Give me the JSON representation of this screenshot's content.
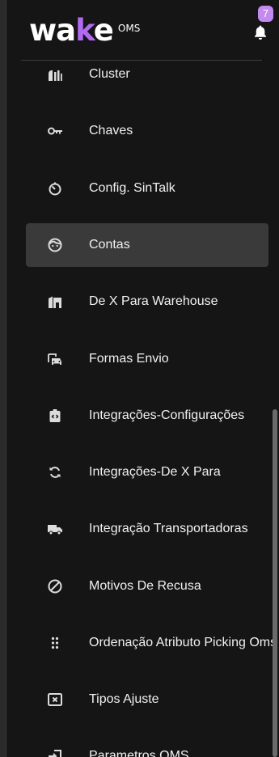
{
  "header": {
    "logo_text_a": "wa",
    "logo_text_k": "k",
    "logo_text_b": "e",
    "logo_sub": "OMS",
    "notification_count": "7"
  },
  "menu": {
    "items": [
      {
        "label": "Cluster",
        "icon": "cluster-icon"
      },
      {
        "label": "Chaves",
        "icon": "key-icon"
      },
      {
        "label": "Config. SinTalk",
        "icon": "timer-icon"
      },
      {
        "label": "Contas",
        "icon": "face-icon"
      },
      {
        "label": "De X Para Warehouse",
        "icon": "warehouse-icon"
      },
      {
        "label": "Formas Envio",
        "icon": "car-icon"
      },
      {
        "label": "Integrações-Configurações",
        "icon": "clipboard-code-icon"
      },
      {
        "label": "Integrações-De X Para",
        "icon": "sync-icon"
      },
      {
        "label": "Integração Transportadoras",
        "icon": "truck-icon"
      },
      {
        "label": "Motivos De Recusa",
        "icon": "block-icon"
      },
      {
        "label": "Ordenação Atributo Picking Oms",
        "icon": "drag-dots-icon"
      },
      {
        "label": "Tipos Ajuste",
        "icon": "close-box-icon"
      },
      {
        "label": "Parametros OMS",
        "icon": "login-icon"
      }
    ],
    "active_label": "Contas"
  }
}
